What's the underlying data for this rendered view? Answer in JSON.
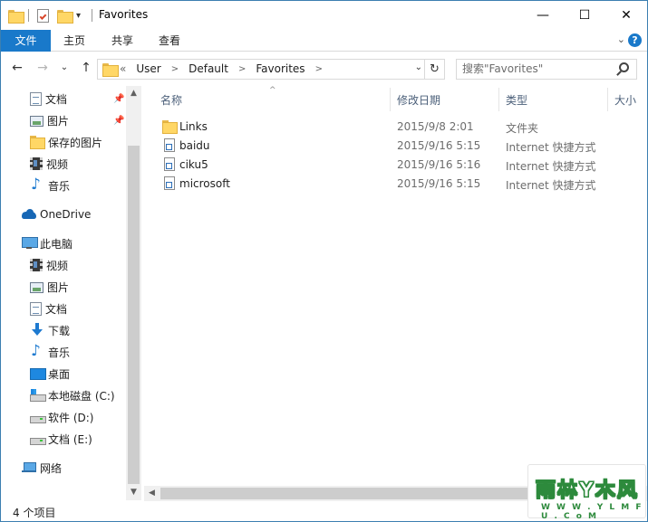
{
  "titlebar": {
    "title": "Favorites",
    "qa_dropdown": "▾",
    "minimize": "—",
    "maximize": "☐",
    "close": "✕"
  },
  "ribbon": {
    "tabs": [
      {
        "label": "文件"
      },
      {
        "label": "主页"
      },
      {
        "label": "共享"
      },
      {
        "label": "查看"
      }
    ],
    "expand": "⌄",
    "help": "?"
  },
  "nav": {
    "back": "←",
    "forward": "→",
    "recent": "⌄",
    "up": "↑",
    "address": {
      "overflow": "«",
      "crumbs": [
        {
          "label": "User"
        },
        {
          "label": "Default"
        },
        {
          "label": "Favorites"
        }
      ],
      "separator": ">",
      "dropdown": "⌄",
      "refresh": "↻"
    },
    "search": {
      "placeholder": "搜索\"Favorites\""
    }
  },
  "sidebar": {
    "quick_access": [
      {
        "label": "文档",
        "icon": "document-icon",
        "pinned": true
      },
      {
        "label": "图片",
        "icon": "pictures-icon",
        "pinned": true
      },
      {
        "label": "保存的图片",
        "icon": "folder-icon",
        "pinned": false
      },
      {
        "label": "视频",
        "icon": "video-icon",
        "pinned": false
      },
      {
        "label": "音乐",
        "icon": "music-icon",
        "pinned": false
      }
    ],
    "onedrive": {
      "label": "OneDrive",
      "icon": "onedrive-icon"
    },
    "this_pc": {
      "label": "此电脑",
      "icon": "computer-icon"
    },
    "pc_items": [
      {
        "label": "视频",
        "icon": "video-icon"
      },
      {
        "label": "图片",
        "icon": "pictures-icon"
      },
      {
        "label": "文档",
        "icon": "document-icon"
      },
      {
        "label": "下载",
        "icon": "download-icon"
      },
      {
        "label": "音乐",
        "icon": "music-icon"
      },
      {
        "label": "桌面",
        "icon": "desktop-icon"
      },
      {
        "label": "本地磁盘 (C:)",
        "icon": "system-drive-icon"
      },
      {
        "label": "软件 (D:)",
        "icon": "drive-icon"
      },
      {
        "label": "文档 (E:)",
        "icon": "drive-icon"
      }
    ],
    "network": {
      "label": "网络",
      "icon": "network-icon"
    },
    "pin_glyph": "📌"
  },
  "list": {
    "columns": [
      {
        "label": "名称"
      },
      {
        "label": "修改日期"
      },
      {
        "label": "类型"
      },
      {
        "label": "大小"
      }
    ],
    "sort_glyph": "^",
    "rows": [
      {
        "name": "Links",
        "date": "2015/9/8 2:01",
        "type": "文件夹",
        "icon": "folder-icon"
      },
      {
        "name": "baidu",
        "date": "2015/9/16 5:15",
        "type": "Internet 快捷方式",
        "icon": "url-shortcut-icon"
      },
      {
        "name": "ciku5",
        "date": "2015/9/16 5:16",
        "type": "Internet 快捷方式",
        "icon": "url-shortcut-icon"
      },
      {
        "name": "microsoft",
        "date": "2015/9/16 5:15",
        "type": "Internet 快捷方式",
        "icon": "url-shortcut-icon"
      }
    ]
  },
  "status": {
    "item_count": "4 个项目"
  },
  "watermark": {
    "main": "雨林Y木风",
    "sub": "W W W . Y L M F U . C o M"
  },
  "colors": {
    "accent": "#1979ca",
    "watermark": "#2d8a3c"
  }
}
